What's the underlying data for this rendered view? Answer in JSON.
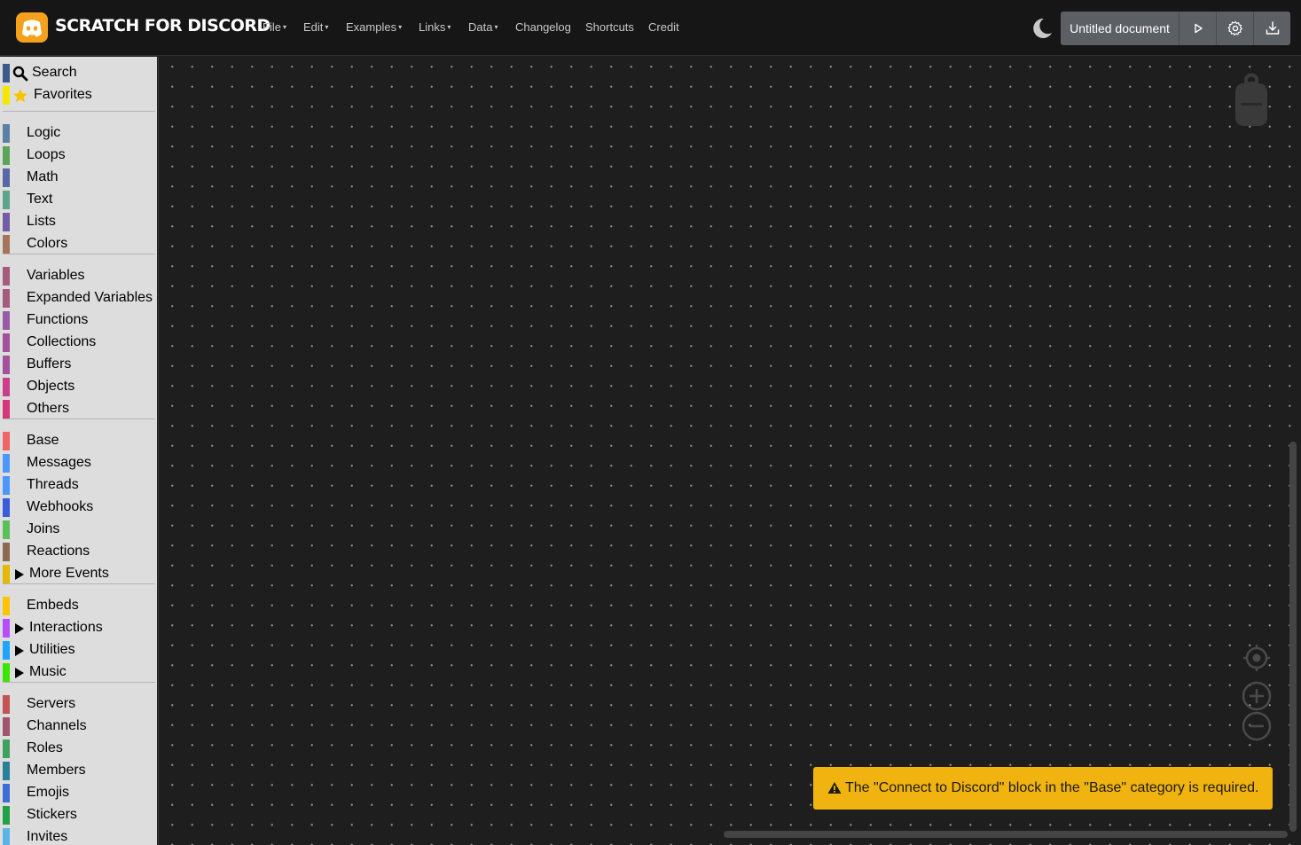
{
  "header": {
    "brand": "SCRATCH FOR DISCORD",
    "menu": [
      {
        "label": "File",
        "dropdown": true
      },
      {
        "label": "Edit",
        "dropdown": true
      },
      {
        "label": "Examples",
        "dropdown": true
      },
      {
        "label": "Links",
        "dropdown": true
      },
      {
        "label": "Data",
        "dropdown": true
      },
      {
        "label": "Changelog",
        "dropdown": false
      },
      {
        "label": "Shortcuts",
        "dropdown": false
      },
      {
        "label": "Credit",
        "dropdown": false
      }
    ],
    "document_name": "Untitled document",
    "icons": {
      "theme": "moon-icon",
      "run": "play-icon",
      "settings": "gear-icon",
      "download": "download-icon"
    },
    "accent": "#f5a11c"
  },
  "sidebar": {
    "search": {
      "label": "Search",
      "color": "#3c5a8c"
    },
    "favorites": {
      "label": "Favorites",
      "color": "#f5e800"
    },
    "groups": [
      [
        {
          "label": "Logic",
          "color": "#5b80a5"
        },
        {
          "label": "Loops",
          "color": "#5ba55b"
        },
        {
          "label": "Math",
          "color": "#5b67a5"
        },
        {
          "label": "Text",
          "color": "#5ba58c"
        },
        {
          "label": "Lists",
          "color": "#745ba5"
        },
        {
          "label": "Colors",
          "color": "#a5745b"
        }
      ],
      [
        {
          "label": "Variables",
          "color": "#a55b80"
        },
        {
          "label": "Expanded Variables",
          "color": "#a55b80"
        },
        {
          "label": "Functions",
          "color": "#995ba5"
        },
        {
          "label": "Collections",
          "color": "#a5509d"
        },
        {
          "label": "Buffers",
          "color": "#a5509d"
        },
        {
          "label": "Objects",
          "color": "#cc3d8e"
        },
        {
          "label": "Others",
          "color": "#d4387a"
        }
      ],
      [
        {
          "label": "Base",
          "color": "#f06466"
        },
        {
          "label": "Messages",
          "color": "#4c97ff"
        },
        {
          "label": "Threads",
          "color": "#4c97ff"
        },
        {
          "label": "Webhooks",
          "color": "#3a5cdb"
        },
        {
          "label": "Joins",
          "color": "#59c059"
        },
        {
          "label": "Reactions",
          "color": "#8c6a4f"
        },
        {
          "label": "More Events",
          "color": "#e6b800",
          "expandable": true
        }
      ],
      [
        {
          "label": "Embeds",
          "color": "#ffc400"
        },
        {
          "label": "Interactions",
          "color": "#b84dff",
          "expandable": true
        },
        {
          "label": "Utilities",
          "color": "#1ea5ff",
          "expandable": true
        },
        {
          "label": "Music",
          "color": "#39e600",
          "expandable": true
        }
      ],
      [
        {
          "label": "Servers",
          "color": "#c45454"
        },
        {
          "label": "Channels",
          "color": "#a0546e"
        },
        {
          "label": "Roles",
          "color": "#40a060"
        },
        {
          "label": "Members",
          "color": "#2a7f9a"
        },
        {
          "label": "Emojis",
          "color": "#3a6fd8"
        },
        {
          "label": "Stickers",
          "color": "#22a045"
        },
        {
          "label": "Invites",
          "color": "#5ab4e8"
        }
      ]
    ]
  },
  "workspace": {
    "toast_message": "The \"Connect to Discord\" block in the \"Base\" category is required.",
    "toast_color": "#f0b30f",
    "icons": {
      "trash": "backpack-icon",
      "recenter": "recenter-icon",
      "zoom_in": "zoom-in-icon",
      "zoom_out": "zoom-out-icon",
      "warning": "warning-icon"
    }
  }
}
